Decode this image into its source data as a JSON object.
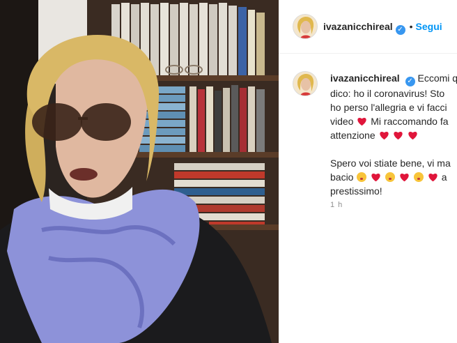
{
  "post": {
    "username": "ivazanicchireal",
    "verified_icon": "verified-badge-icon",
    "dot": "•",
    "follow_label": "Segui",
    "caption_lines": [
      "Eccomi q",
      "dico: ho il coronavirus! Sto",
      "ho perso l'allegria e vi facci",
      "video",
      "Mi raccomando fa",
      "attenzione",
      "Spero voi stiate bene, vi ma",
      "bacio",
      "a",
      "prestissimo!"
    ],
    "time": "1 h"
  },
  "icons": {
    "heart": "red-heart-icon",
    "kiss": "kissing-face-icon",
    "verified": "verified-badge-icon"
  },
  "colors": {
    "accent": "#0095f6",
    "verified": "#3897f0",
    "heart": "#e0163b",
    "text": "#262626",
    "muted": "#8e8e8e"
  }
}
